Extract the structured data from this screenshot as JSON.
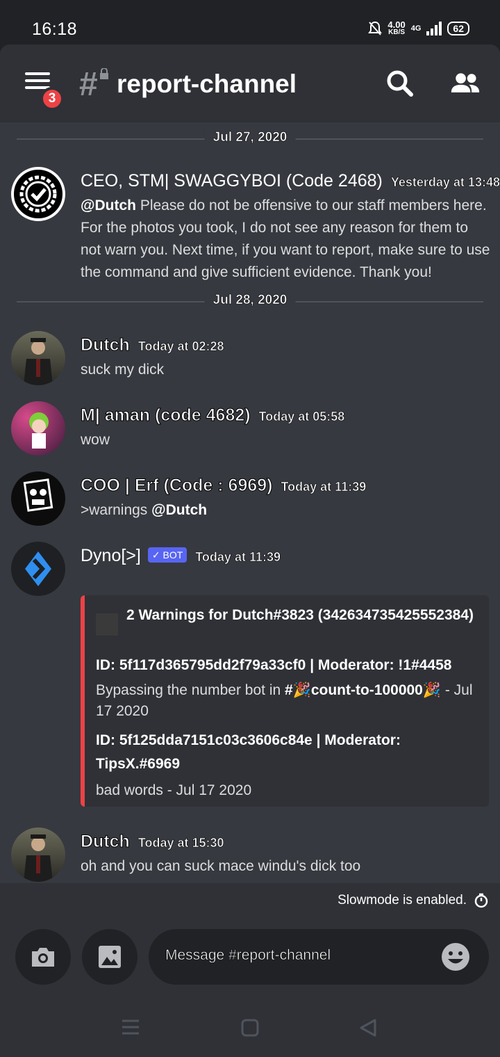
{
  "status_bar": {
    "time": "16:18",
    "speed": "4.00",
    "speed_unit": "KB/S",
    "network": "4G",
    "battery": "62"
  },
  "header": {
    "channel_name": "report-channel",
    "notification_count": "3"
  },
  "dividers": [
    "Jul 27, 2020",
    "Jul 28, 2020"
  ],
  "messages": [
    {
      "author": "CEO, STM| SWAGGYBOI (Code 2468)",
      "timestamp": "Yesterday at 13:48",
      "mention": "@Dutch",
      "text": " Please do not be offensive to our staff members here. For the photos you took, I do not see any reason for them to not warn you. Next time, if you want to report, make sure to use the command and give sufficient evidence. Thank you!"
    },
    {
      "author": "Dutch",
      "timestamp": "Today at 02:28",
      "text": "suck my dick"
    },
    {
      "author": "M| aman (code 4682)",
      "timestamp": "Today at 05:58",
      "text": "wow"
    },
    {
      "author": "COO | Erf (Code : 6969)",
      "timestamp": "Today at 11:39",
      "text": ">warnings ",
      "mention": "@Dutch"
    },
    {
      "author": "Dyno[>]",
      "bot_tag": "BOT",
      "timestamp": "Today at 11:39"
    },
    {
      "author": "Dutch",
      "timestamp": "Today at 15:30",
      "text": "oh and you can suck mace windu's dick too"
    }
  ],
  "embed": {
    "title": "2 Warnings for Dutch#3823 (342634735425552384)",
    "warning1_header": "ID: 5f117d365795dd2f79a33cf0 | Moderator: !1#4458",
    "warning1_text_pre": "Bypassing the number bot in ",
    "warning1_channel": "#🎉count-to-100000🎉",
    "warning1_text_post": " - Jul 17 2020",
    "warning2_header": "ID: 5f125dda7151c03c3606c84e | Moderator: TipsX.#6969",
    "warning2_text": "bad words - Jul 17 2020"
  },
  "slowmode": {
    "text": "Slowmode is enabled."
  },
  "composer": {
    "placeholder": "Message #report-channel"
  },
  "colors": {
    "background": "#36393f",
    "header": "#2f3136",
    "accent": "#5865f2",
    "embed_border": "#ed4245"
  }
}
